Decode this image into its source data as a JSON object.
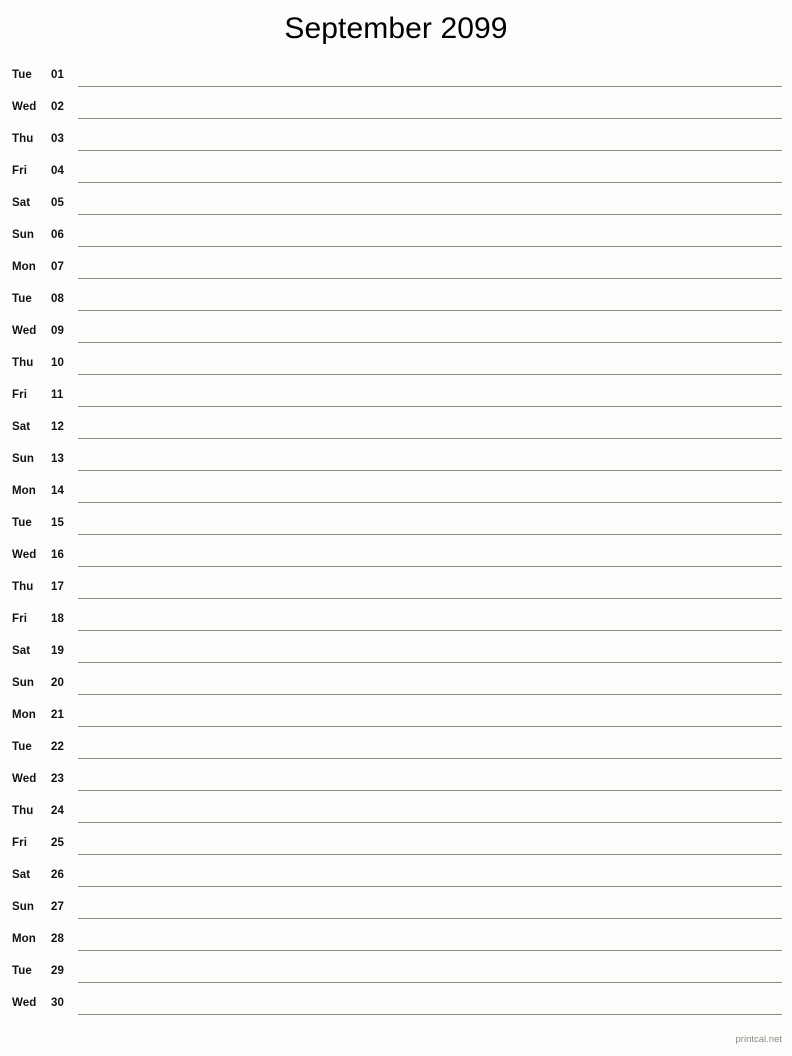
{
  "header": {
    "title": "September 2099",
    "month": "September",
    "year": "2099"
  },
  "footer": {
    "credit": "printcal.net"
  },
  "colors": {
    "background": "#fdfdfb",
    "text": "#111111",
    "title": "#000000",
    "rule": "#8a8a85",
    "footer": "#8a8a85"
  },
  "calendar": {
    "days": [
      {
        "weekday": "Tue",
        "date": "01"
      },
      {
        "weekday": "Wed",
        "date": "02"
      },
      {
        "weekday": "Thu",
        "date": "03"
      },
      {
        "weekday": "Fri",
        "date": "04"
      },
      {
        "weekday": "Sat",
        "date": "05"
      },
      {
        "weekday": "Sun",
        "date": "06"
      },
      {
        "weekday": "Mon",
        "date": "07"
      },
      {
        "weekday": "Tue",
        "date": "08"
      },
      {
        "weekday": "Wed",
        "date": "09"
      },
      {
        "weekday": "Thu",
        "date": "10"
      },
      {
        "weekday": "Fri",
        "date": "11"
      },
      {
        "weekday": "Sat",
        "date": "12"
      },
      {
        "weekday": "Sun",
        "date": "13"
      },
      {
        "weekday": "Mon",
        "date": "14"
      },
      {
        "weekday": "Tue",
        "date": "15"
      },
      {
        "weekday": "Wed",
        "date": "16"
      },
      {
        "weekday": "Thu",
        "date": "17"
      },
      {
        "weekday": "Fri",
        "date": "18"
      },
      {
        "weekday": "Sat",
        "date": "19"
      },
      {
        "weekday": "Sun",
        "date": "20"
      },
      {
        "weekday": "Mon",
        "date": "21"
      },
      {
        "weekday": "Tue",
        "date": "22"
      },
      {
        "weekday": "Wed",
        "date": "23"
      },
      {
        "weekday": "Thu",
        "date": "24"
      },
      {
        "weekday": "Fri",
        "date": "25"
      },
      {
        "weekday": "Sat",
        "date": "26"
      },
      {
        "weekday": "Sun",
        "date": "27"
      },
      {
        "weekday": "Mon",
        "date": "28"
      },
      {
        "weekday": "Tue",
        "date": "29"
      },
      {
        "weekday": "Wed",
        "date": "30"
      }
    ]
  }
}
